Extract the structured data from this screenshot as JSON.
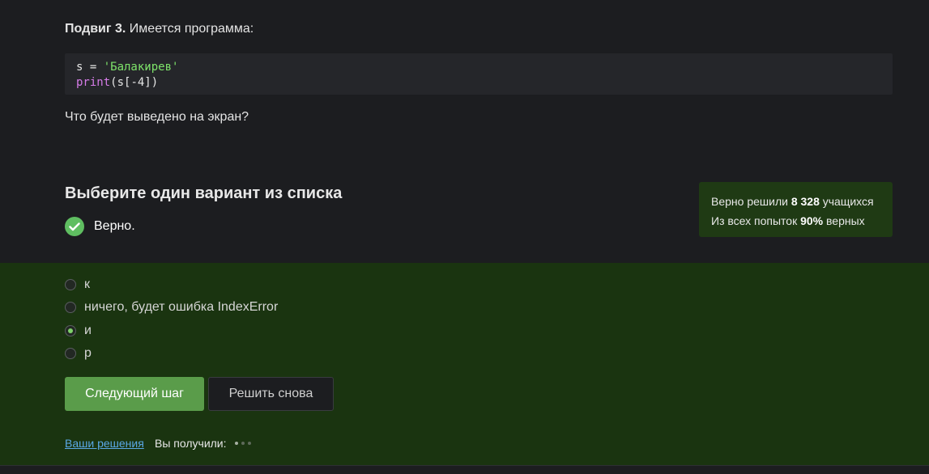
{
  "task": {
    "title_bold": "Подвиг 3.",
    "title_rest": " Имеется программа:",
    "code": {
      "line1_var": "s = ",
      "line1_str": "'Балакирев'",
      "line2_fn": "print",
      "line2_rest": "(s[-4])"
    },
    "question": "Что будет выведено на экран?"
  },
  "quiz": {
    "title": "Выберите один вариант из списка",
    "status_text": "Верно.",
    "options": [
      {
        "label": "к",
        "selected": false
      },
      {
        "label": "ничего, будет ошибка IndexError",
        "selected": false
      },
      {
        "label": "и",
        "selected": true
      },
      {
        "label": "р",
        "selected": false
      }
    ]
  },
  "stats": {
    "line1_prefix": "Верно решили ",
    "solved_count": "8 328",
    "line1_suffix": " учащихся",
    "line2_prefix": "Из всех попыток ",
    "percent": "90%",
    "line2_suffix": " верных"
  },
  "actions": {
    "next_label": "Следующий шаг",
    "retry_label": "Решить снова"
  },
  "footer": {
    "solutions_link": "Ваши решения",
    "received_label": "Вы получили:"
  },
  "colors": {
    "accent_green": "#5a9c4a",
    "success_check": "#5fbe61",
    "link_blue": "#5aa8e6"
  },
  "icons": {
    "status": "check-circle-icon"
  }
}
